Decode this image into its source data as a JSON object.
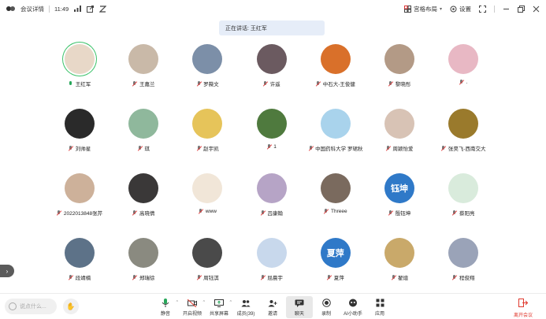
{
  "titlebar": {
    "meeting_details": "会议详情",
    "time": "11:49",
    "layout_label": "宫格布局",
    "settings_label": "设置"
  },
  "speaking_banner": "正在讲话: 王红军",
  "participants": [
    {
      "name": "王红军",
      "mic": "on",
      "color": "#e8d8c8",
      "glyph": "",
      "speaking": true
    },
    {
      "name": "王嘉兰",
      "mic": "muted",
      "color": "#c9b9a8",
      "glyph": ""
    },
    {
      "name": "罗薇文",
      "mic": "muted",
      "color": "#7c8fa8",
      "glyph": ""
    },
    {
      "name": "许遥",
      "mic": "muted",
      "color": "#6b5a60",
      "glyph": ""
    },
    {
      "name": "中石大-王俊健",
      "mic": "muted",
      "color": "#d9702a",
      "glyph": ""
    },
    {
      "name": "黎晓彤",
      "mic": "muted",
      "color": "#b39a86",
      "glyph": ""
    },
    {
      "name": ".",
      "mic": "muted",
      "color": "#e8b8c4",
      "glyph": ""
    },
    {
      "name": "刘帅星",
      "mic": "muted",
      "color": "#2a2a2a",
      "glyph": ""
    },
    {
      "name": "琪",
      "mic": "muted",
      "color": "#8fb89c",
      "glyph": ""
    },
    {
      "name": "赵宇凯",
      "mic": "muted",
      "color": "#e6c45a",
      "glyph": ""
    },
    {
      "name": "1",
      "mic": "muted",
      "color": "#4f7a3e",
      "glyph": ""
    },
    {
      "name": "中国药科大学 罗珺秋",
      "mic": "muted",
      "color": "#a9d3ec",
      "glyph": ""
    },
    {
      "name": "周颖怡爱",
      "mic": "muted",
      "color": "#d8c3b5",
      "glyph": ""
    },
    {
      "name": "张昊飞-西南交大",
      "mic": "muted",
      "color": "#9a7a2c",
      "glyph": ""
    },
    {
      "name": "2022013848张芹",
      "mic": "muted",
      "color": "#cdb19a",
      "glyph": ""
    },
    {
      "name": "高晓倩",
      "mic": "muted",
      "color": "#3a3838",
      "glyph": ""
    },
    {
      "name": "www",
      "mic": "muted",
      "color": "#f1e6d8",
      "glyph": ""
    },
    {
      "name": "吕康翰",
      "mic": "muted",
      "color": "#b6a4c6",
      "glyph": ""
    },
    {
      "name": "Threee",
      "mic": "muted",
      "color": "#7a6a5e",
      "glyph": ""
    },
    {
      "name": "殷钰坤",
      "mic": "muted",
      "color": "#2f79c8",
      "glyph": "钰坤"
    },
    {
      "name": "蔡阳亮",
      "mic": "muted",
      "color": "#d9ebdc",
      "glyph": ""
    },
    {
      "name": "段靖楠",
      "mic": "muted",
      "color": "#5d7288",
      "glyph": ""
    },
    {
      "name": "郑瑞徐",
      "mic": "muted",
      "color": "#8a8a80",
      "glyph": ""
    },
    {
      "name": "周钰淇",
      "mic": "muted",
      "color": "#4a4a4a",
      "glyph": ""
    },
    {
      "name": "屈晨宇",
      "mic": "muted",
      "color": "#c8d8ec",
      "glyph": ""
    },
    {
      "name": "夏萍",
      "mic": "muted",
      "color": "#2f79c8",
      "glyph": "夏萍"
    },
    {
      "name": "翟煊",
      "mic": "muted",
      "color": "#c9a96a",
      "glyph": ""
    },
    {
      "name": "程俊翔",
      "mic": "muted",
      "color": "#9aa3b8",
      "glyph": ""
    }
  ],
  "bottombar": {
    "chat_placeholder": "说点什么...",
    "tools": [
      {
        "label": "静音",
        "icon": "microphone-icon"
      },
      {
        "label": "开启视频",
        "icon": "video-off-icon"
      },
      {
        "label": "共享屏幕",
        "icon": "screen-share-icon"
      },
      {
        "label": "成员(39)",
        "icon": "members-icon"
      },
      {
        "label": "邀请",
        "icon": "invite-icon"
      },
      {
        "label": "聊天",
        "icon": "chat-icon"
      },
      {
        "label": "录制",
        "icon": "record-icon"
      },
      {
        "label": "AI小助手",
        "icon": "ai-assistant-icon"
      },
      {
        "label": "应用",
        "icon": "apps-icon"
      }
    ],
    "leave_label": "离开会议"
  }
}
